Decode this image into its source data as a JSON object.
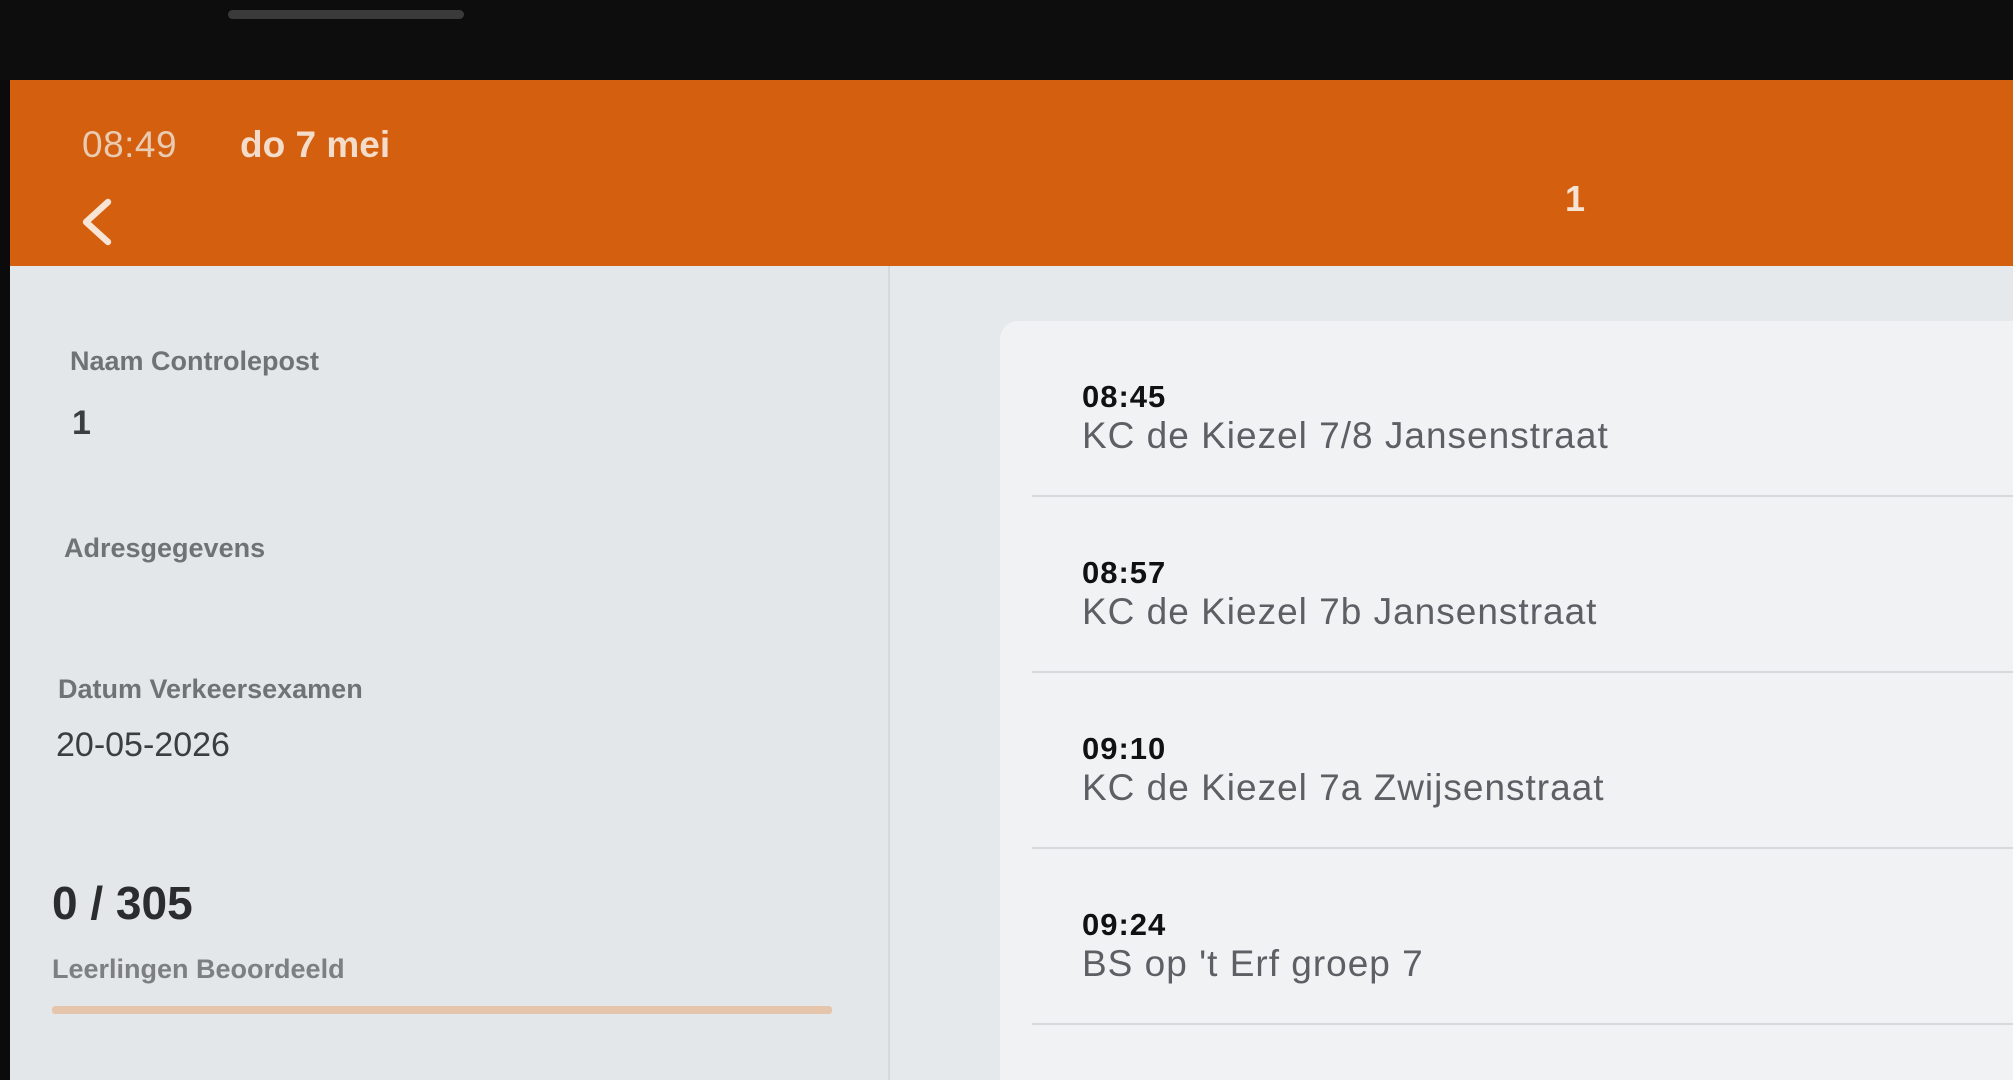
{
  "status_bar": {
    "time": "08:49",
    "date": "do 7 mei"
  },
  "app_bar": {
    "back_icon": "chevron-left-icon",
    "title": "1"
  },
  "details": {
    "name_label": "Naam Controlepost",
    "name_value": "1",
    "address_label": "Adresgegevens",
    "address_value": "",
    "exam_date_label": "Datum Verkeersexamen",
    "exam_date_value": "20-05-2026"
  },
  "progress": {
    "count_text": "0 / 305",
    "label": "Leerlingen Beoordeeld",
    "fraction": 0
  },
  "schedule": [
    {
      "time": "08:45",
      "name": "KC de Kiezel 7/8 Jansenstraat"
    },
    {
      "time": "08:57",
      "name": "KC de Kiezel 7b Jansenstraat"
    },
    {
      "time": "09:10",
      "name": "KC de Kiezel 7a Zwijsenstraat"
    },
    {
      "time": "09:24",
      "name": "BS op 't Erf groep 7"
    }
  ],
  "colors": {
    "accent": "#d35f0f",
    "background": "#e7e9ea"
  }
}
